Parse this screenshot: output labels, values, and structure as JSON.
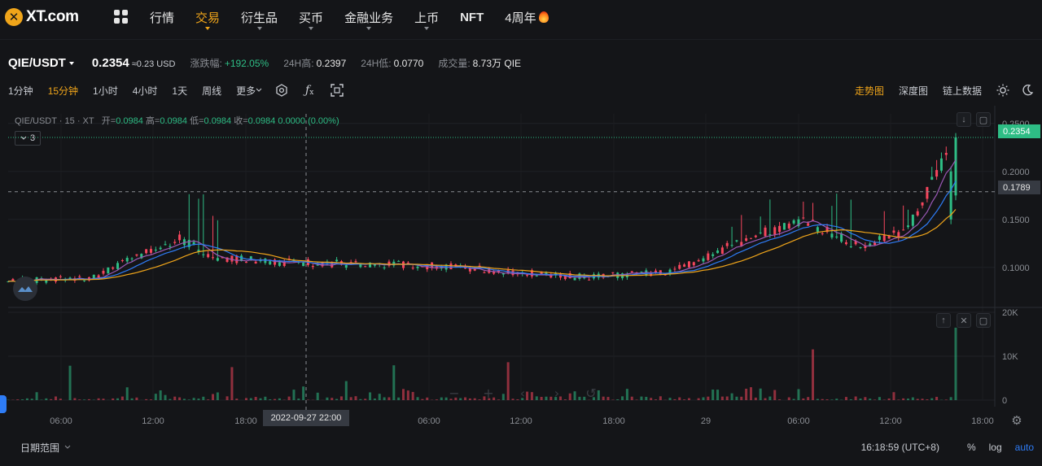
{
  "logo": {
    "text": "XT.com",
    "mark": "✕"
  },
  "nav": [
    {
      "label": "行情",
      "active": false,
      "caret": false
    },
    {
      "label": "交易",
      "active": true,
      "caret": true
    },
    {
      "label": "衍生品",
      "active": false,
      "caret": true
    },
    {
      "label": "买币",
      "active": false,
      "caret": true
    },
    {
      "label": "金融业务",
      "active": false,
      "caret": true
    },
    {
      "label": "上币",
      "active": false,
      "caret": true
    },
    {
      "label": "NFT",
      "active": false,
      "caret": false
    },
    {
      "label": "4周年",
      "active": false,
      "caret": false
    }
  ],
  "ticker": {
    "pair": "QIE/USDT",
    "last": "0.2354",
    "fiat": "≈0.23 USD",
    "change_label": "涨跌幅:",
    "change_value": "+192.05%",
    "high_label": "24H高:",
    "high_value": "0.2397",
    "low_label": "24H低:",
    "low_value": "0.0770",
    "vol_label": "成交量:",
    "vol_value": "8.73万 QIE"
  },
  "toolbar": {
    "timeframes": [
      "1分钟",
      "15分钟",
      "1小时",
      "4小时",
      "1天",
      "周线",
      "更多"
    ],
    "active_timeframe": "15分钟",
    "right": [
      "走势图",
      "深度图",
      "链上数据"
    ],
    "right_active": "走势图"
  },
  "chart_header": {
    "title": "QIE/USDT · 15 · XT",
    "open_label": "开=",
    "open": "0.0984",
    "high_label": "高=",
    "high": "0.0984",
    "low_label": "低=",
    "low": "0.0984",
    "close_label": "收=",
    "close": "0.0984",
    "change": "0.0000 (0.00%)",
    "indicator_count": "3"
  },
  "price_axis": [
    "0.2500",
    "0.2000",
    "0.1500",
    "0.1000"
  ],
  "volume_axis": [
    "20K",
    "10K",
    "0"
  ],
  "time_axis": [
    "06:00",
    "12:00",
    "18:00",
    "06:00",
    "12:00",
    "18:00",
    "29",
    "06:00",
    "12:00",
    "18:00"
  ],
  "tags": {
    "last_price": "0.2354",
    "crosshair_price": "0.1789"
  },
  "crosshair_label": "2022-09-27   22:00",
  "bottom": {
    "date_range": "日期范围",
    "clock": "16:18:59 (UTC+8)",
    "pct": "%",
    "log": "log",
    "auto": "auto"
  },
  "colors": {
    "up": "#2ebd85",
    "down": "#f6465d",
    "accent": "#f0a51a",
    "ma_blue": "#2e7cf6",
    "ma_orange": "#f0a51a",
    "ma_purple": "#9b59b6"
  },
  "chart_data": {
    "type": "candlestick",
    "candle_span": "from 04:00 day 1 to 16:00 day 3 (15m)",
    "price_range": [
      0.06,
      0.26
    ],
    "volume_range": [
      0,
      20000
    ],
    "key_points": [
      {
        "t": 0.0,
        "o": 0.09,
        "h": 0.098,
        "l": 0.08,
        "c": 0.085
      },
      {
        "t": 0.09,
        "o": 0.085,
        "h": 0.1,
        "l": 0.082,
        "c": 0.09
      },
      {
        "t": 0.18,
        "o": 0.095,
        "h": 0.212,
        "l": 0.092,
        "c": 0.13
      },
      {
        "t": 0.22,
        "o": 0.13,
        "h": 0.16,
        "l": 0.1,
        "c": 0.11
      },
      {
        "t": 0.3,
        "o": 0.11,
        "h": 0.118,
        "l": 0.098,
        "c": 0.105
      },
      {
        "t": 0.45,
        "o": 0.104,
        "h": 0.112,
        "l": 0.098,
        "c": 0.102
      },
      {
        "t": 0.6,
        "o": 0.1,
        "h": 0.11,
        "l": 0.08,
        "c": 0.09
      },
      {
        "t": 0.7,
        "o": 0.09,
        "h": 0.115,
        "l": 0.078,
        "c": 0.095
      },
      {
        "t": 0.78,
        "o": 0.1,
        "h": 0.165,
        "l": 0.095,
        "c": 0.13
      },
      {
        "t": 0.84,
        "o": 0.135,
        "h": 0.18,
        "l": 0.13,
        "c": 0.15
      },
      {
        "t": 0.9,
        "o": 0.13,
        "h": 0.175,
        "l": 0.11,
        "c": 0.12
      },
      {
        "t": 0.95,
        "o": 0.12,
        "h": 0.17,
        "l": 0.11,
        "c": 0.14
      },
      {
        "t": 1.0,
        "o": 0.18,
        "h": 0.24,
        "l": 0.17,
        "c": 0.235
      }
    ]
  }
}
